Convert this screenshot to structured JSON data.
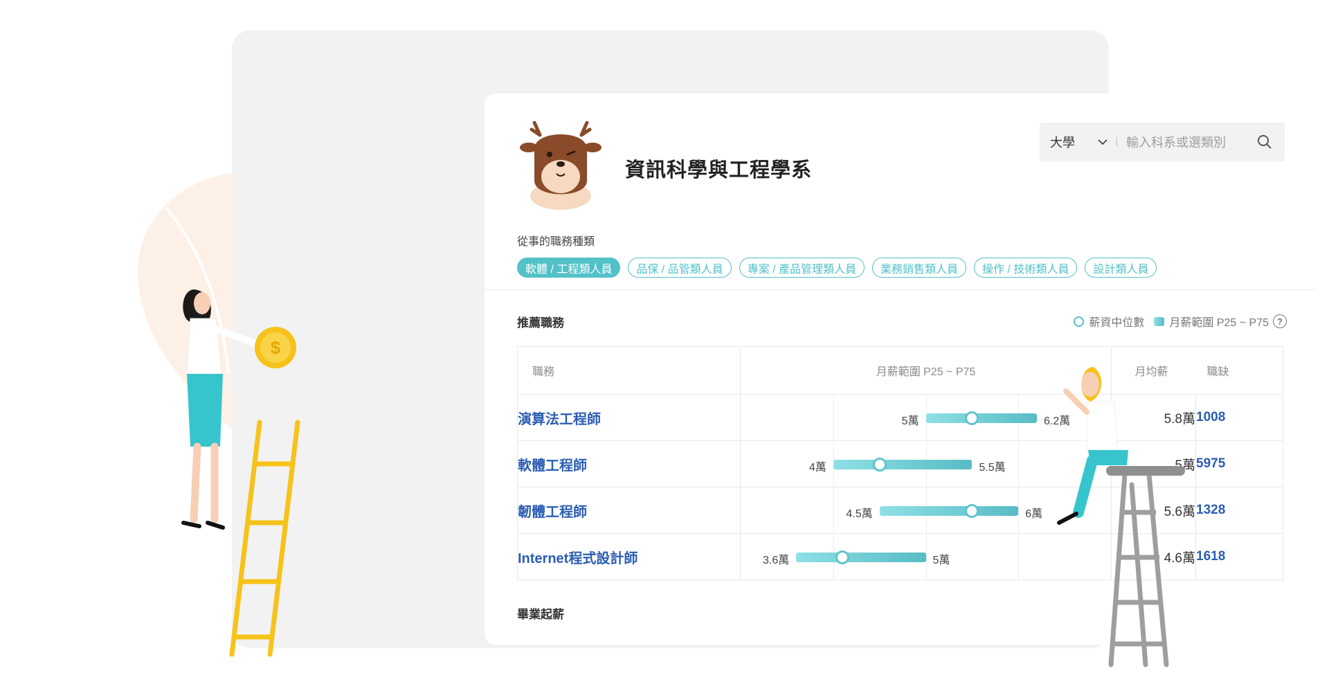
{
  "department": {
    "title": "資訊科學與工程學系",
    "mascot": "deer-mascot"
  },
  "search": {
    "level": "大學",
    "placeholder": "輸入科系或選類別"
  },
  "job_categories": {
    "label": "從事的職務種類",
    "items": [
      {
        "label": "軟體 / 工程類人員",
        "active": true
      },
      {
        "label": "品保 / 品管類人員",
        "active": false
      },
      {
        "label": "專案 / 產品管理類人員",
        "active": false
      },
      {
        "label": "業務銷售類人員",
        "active": false
      },
      {
        "label": "操作 / 技術類人員",
        "active": false
      },
      {
        "label": "設計類人員",
        "active": false
      }
    ]
  },
  "recommended": {
    "title": "推薦職務",
    "legend": {
      "median": "薪資中位數",
      "range": "月薪範圍 P25 ~ P75",
      "help": "?"
    },
    "headers": {
      "job": "職務",
      "range": "月薪範圍 P25 ~ P75",
      "avg": "月均薪",
      "openings": "職缺"
    },
    "rows": [
      {
        "job": "演算法工程師",
        "p25_label": "5萬",
        "p75_label": "6.2萬",
        "avg": "5.8萬",
        "openings": "1008"
      },
      {
        "job": "軟體工程師",
        "p25_label": "4萬",
        "p75_label": "5.5萬",
        "avg": "5萬",
        "openings": "5975"
      },
      {
        "job": "韌體工程師",
        "p25_label": "4.5萬",
        "p75_label": "6萬",
        "avg": "5.6萬",
        "openings": "1328"
      },
      {
        "job": "Internet程式設計師",
        "p25_label": "3.6萬",
        "p75_label": "5萬",
        "avg": "4.6萬",
        "openings": "1618"
      }
    ]
  },
  "range_values": [
    {
      "p25": 5.0,
      "median": 5.5,
      "p75": 6.2
    },
    {
      "p25": 4.0,
      "median": 4.5,
      "p75": 5.5
    },
    {
      "p25": 4.5,
      "median": 5.5,
      "p75": 6.0
    },
    {
      "p25": 3.6,
      "median": 4.1,
      "p75": 5.0
    }
  ],
  "grad_salary": {
    "title": "畢業起薪"
  },
  "colors": {
    "accent": "#52c1c8",
    "link": "#2a5db2"
  }
}
